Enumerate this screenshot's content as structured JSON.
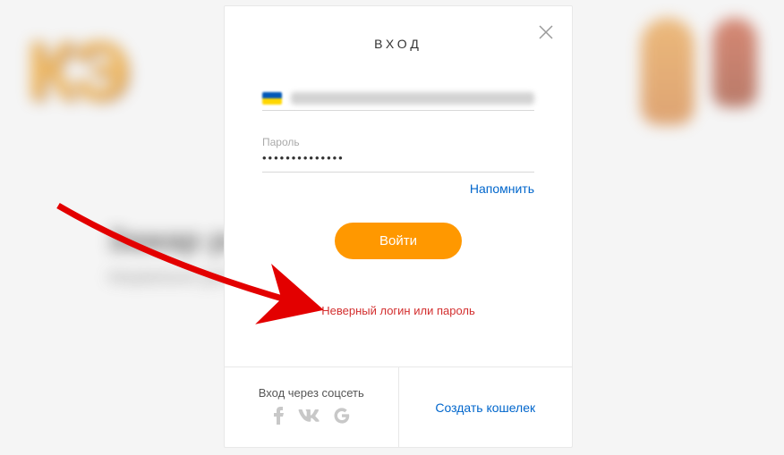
{
  "modal": {
    "title": "ВХОД",
    "password_label": "Пароль",
    "password_mask": "••••••••••••••",
    "remind_link": "Напомнить",
    "submit_label": "Войти",
    "error_message": "Неверный логин или пароль"
  },
  "footer": {
    "social_label": "Вход через соцсеть",
    "create_wallet": "Создать кошелек"
  },
  "background": {
    "logo_fragment": "КЭ",
    "headline": "Зажар                                      рнее",
    "sub": "пециально для онлайн                                                     сти с каждой покупки!"
  },
  "icons": {
    "close": "close-icon",
    "flag": "ukraine-flag-icon",
    "facebook": "facebook-icon",
    "vk": "vk-icon",
    "google": "google-icon"
  }
}
